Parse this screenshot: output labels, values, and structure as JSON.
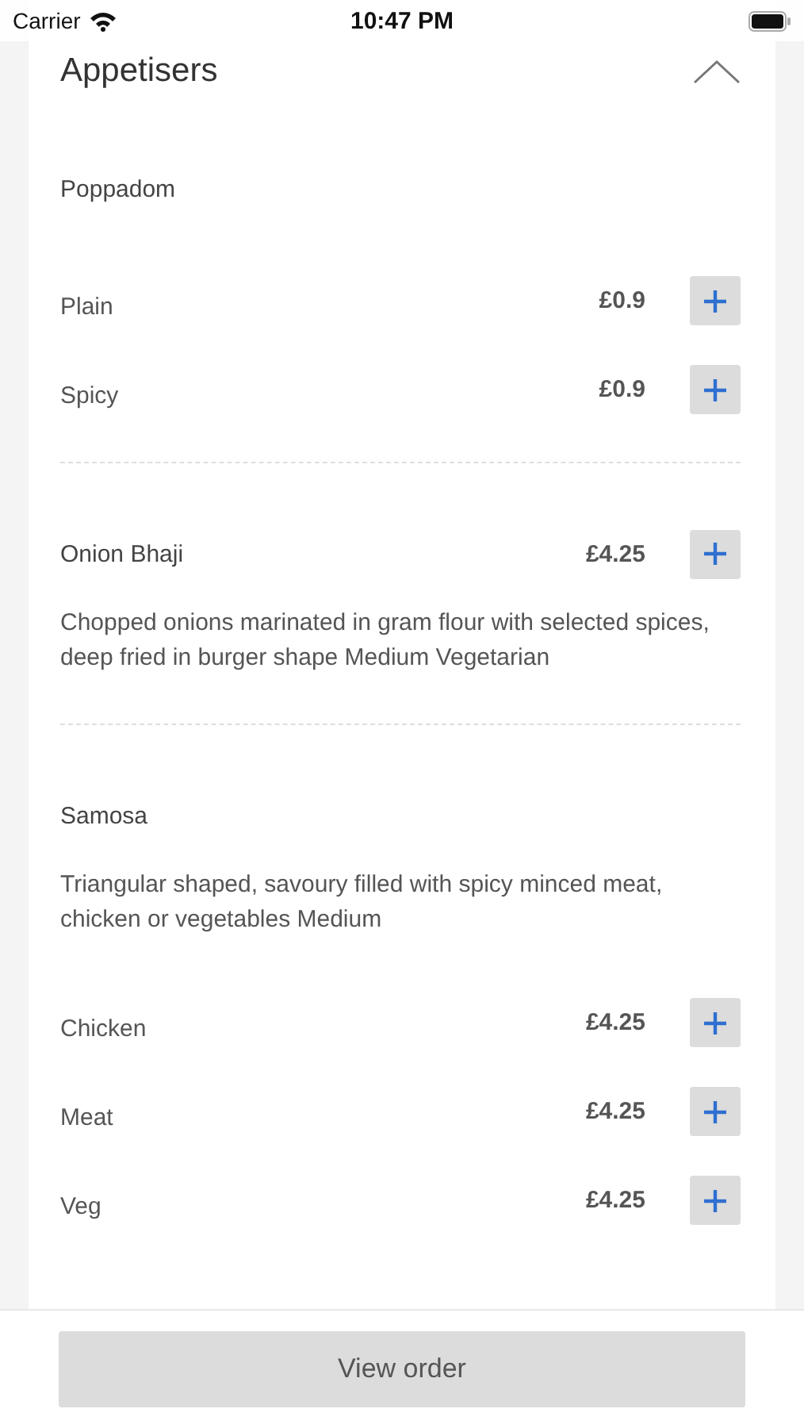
{
  "status_bar": {
    "carrier": "Carrier",
    "time": "10:47 PM"
  },
  "section": {
    "title": "Appetisers",
    "expanded": true,
    "groups": [
      {
        "name": "Poppadom",
        "options": [
          {
            "name": "Plain",
            "price": "£0.9"
          },
          {
            "name": "Spicy",
            "price": "£0.9"
          }
        ]
      },
      {
        "name": "Onion Bhaji",
        "price": "£4.25",
        "description": "Chopped onions marinated in gram flour with selected spices, deep fried in burger shape Medium Vegetarian"
      },
      {
        "name": "Samosa",
        "description": "Triangular shaped, savoury filled with spicy minced meat, chicken or vegetables Medium",
        "options": [
          {
            "name": "Chicken",
            "price": "£4.25"
          },
          {
            "name": "Meat",
            "price": "£4.25"
          },
          {
            "name": "Veg",
            "price": "£4.25"
          }
        ]
      }
    ]
  },
  "footer": {
    "button": "View order"
  }
}
